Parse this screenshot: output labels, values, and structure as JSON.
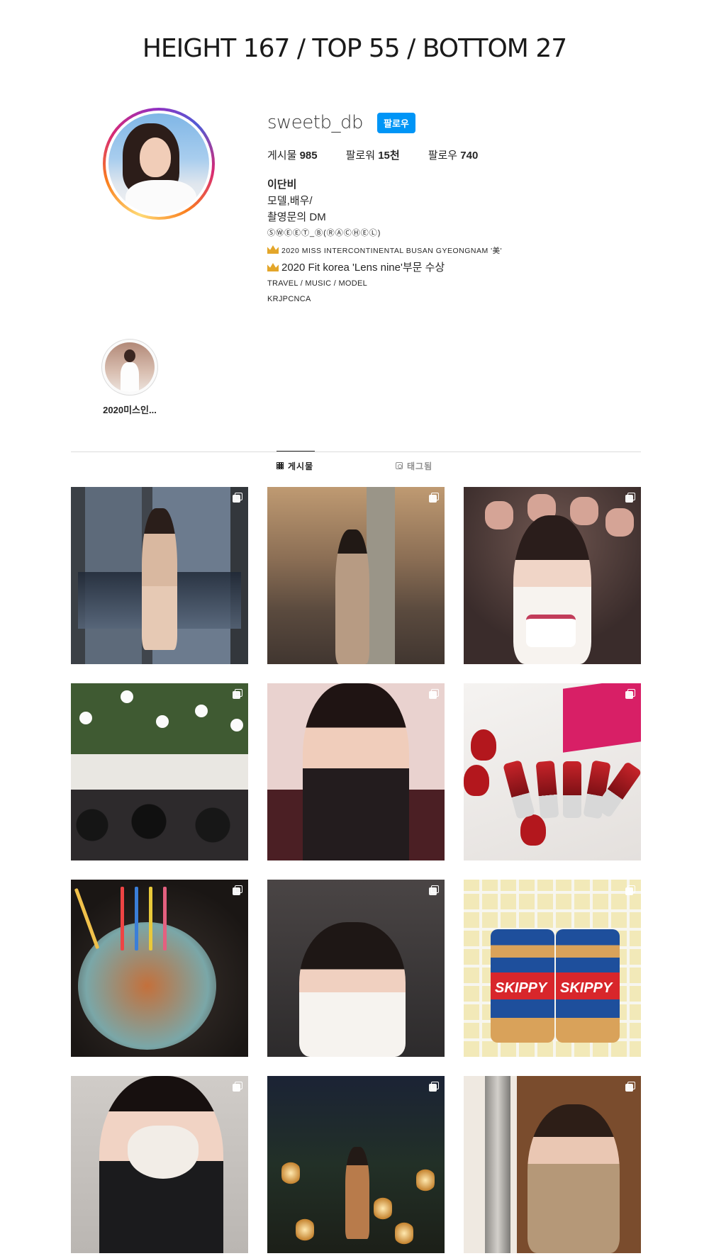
{
  "banner": {
    "text": "HEIGHT 167  /  TOP 55  /  BOTTOM 27"
  },
  "profile": {
    "username": "sweetb_db",
    "follow_label": "팔로우",
    "stats": [
      {
        "label": "게시물",
        "value": "985"
      },
      {
        "label": "팔로워",
        "value": "15천"
      },
      {
        "label": "팔로우",
        "value": "740"
      }
    ],
    "bio": {
      "name": "이단비",
      "line1": "모델,배우/",
      "line2": "촬영문의 DM",
      "line3": "ⓈⓌⒺⒺⓉ_Ⓑ(ⓇⒶⒸⒽⒺⓁ)",
      "line4": "2020 MISS INTERCONTINENTAL BUSAN GYEONGNAM '美'",
      "line5": "2020 Fit korea 'Lens nine'부문 수상",
      "line6": "TRAVEL / MUSIC / MODEL",
      "line7": "KRJPCNCA"
    }
  },
  "highlight": {
    "label": "2020미스인..."
  },
  "tabs": [
    {
      "label": "게시물",
      "icon": "grid-icon",
      "active": true
    },
    {
      "label": "태그됨",
      "icon": "tag-icon",
      "active": false
    }
  ],
  "posts": [
    {
      "id": "1",
      "multi": true
    },
    {
      "id": "2",
      "multi": true
    },
    {
      "id": "3",
      "multi": true
    },
    {
      "id": "4",
      "multi": true
    },
    {
      "id": "5",
      "multi": true
    },
    {
      "id": "6",
      "multi": true
    },
    {
      "id": "7",
      "multi": true
    },
    {
      "id": "8",
      "multi": true
    },
    {
      "id": "9",
      "multi": true,
      "text": "SKIPPY"
    },
    {
      "id": "10",
      "multi": true
    },
    {
      "id": "11",
      "multi": true
    },
    {
      "id": "12",
      "multi": true
    }
  ],
  "colors": {
    "follow_button": "#0095f6",
    "divider": "#dbdbdb",
    "text": "#262626",
    "muted": "#8e8e8e"
  }
}
